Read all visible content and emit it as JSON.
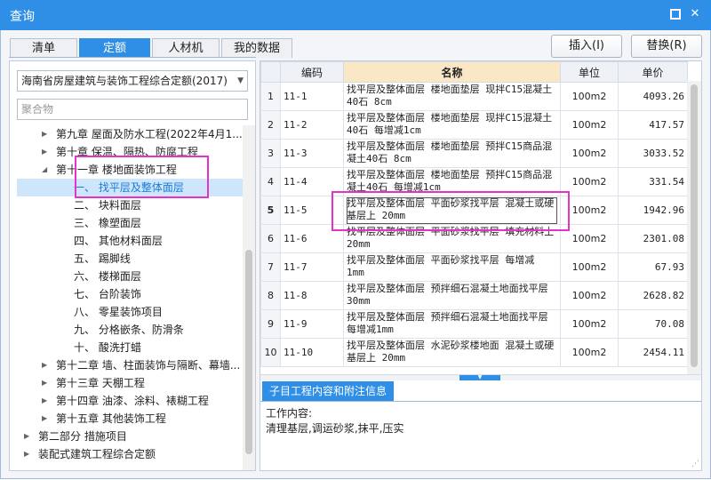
{
  "window": {
    "title": "查询",
    "restore_glyph": "▫",
    "close_glyph": "✕"
  },
  "tabs": [
    {
      "label": "清单",
      "active": false
    },
    {
      "label": "定额",
      "active": true
    },
    {
      "label": "人材机",
      "active": false
    },
    {
      "label": "我的数据",
      "active": false
    }
  ],
  "toolbar": {
    "insert_label": "插入(I)",
    "replace_label": "替换(R)"
  },
  "left": {
    "dropdown_value": "海南省房屋建筑与装饰工程综合定额(2017)",
    "search_value": "聚合物",
    "tree": [
      {
        "label": "第九章 屋面及防水工程(2022年4月1...",
        "expander": "▶",
        "level": 1,
        "selected": false
      },
      {
        "label": "第十章 保温、隔热、防腐工程",
        "expander": "▶",
        "level": 1,
        "selected": false
      },
      {
        "label": "第十一章 楼地面装饰工程",
        "expander": "◢",
        "level": 1,
        "selected": false
      },
      {
        "label": "一、 找平层及整体面层",
        "expander": "",
        "level": 2,
        "selected": true
      },
      {
        "label": "二、 块料面层",
        "expander": "",
        "level": 2,
        "selected": false
      },
      {
        "label": "三、 橡塑面层",
        "expander": "",
        "level": 2,
        "selected": false
      },
      {
        "label": "四、 其他材料面层",
        "expander": "",
        "level": 2,
        "selected": false
      },
      {
        "label": "五、 踢脚线",
        "expander": "",
        "level": 2,
        "selected": false
      },
      {
        "label": "六、 楼梯面层",
        "expander": "",
        "level": 2,
        "selected": false
      },
      {
        "label": "七、 台阶装饰",
        "expander": "",
        "level": 2,
        "selected": false
      },
      {
        "label": "八、 零星装饰项目",
        "expander": "",
        "level": 2,
        "selected": false
      },
      {
        "label": "九、 分格嵌条、防滑条",
        "expander": "",
        "level": 2,
        "selected": false
      },
      {
        "label": "十、 酸洗打蜡",
        "expander": "",
        "level": 2,
        "selected": false
      },
      {
        "label": "第十二章 墙、柱面装饰与隔断、幕墙...",
        "expander": "▶",
        "level": 1,
        "selected": false
      },
      {
        "label": "第十三章 天棚工程",
        "expander": "▶",
        "level": 1,
        "selected": false
      },
      {
        "label": "第十四章 油漆、涂料、裱糊工程",
        "expander": "▶",
        "level": 1,
        "selected": false
      },
      {
        "label": "第十五章 其他装饰工程",
        "expander": "▶",
        "level": 1,
        "selected": false
      },
      {
        "label": "第二部分 措施项目",
        "expander": "▶",
        "level": 0,
        "selected": false
      },
      {
        "label": "装配式建筑工程综合定额",
        "expander": "▶",
        "level": 0,
        "selected": false
      }
    ]
  },
  "grid": {
    "headers": {
      "code": "编码",
      "name": "名称",
      "unit": "单位",
      "price": "单价"
    },
    "rows": [
      {
        "no": "1",
        "code": "11-1",
        "name": "找平层及整体面层 楼地面垫层 现拌C15混凝土40石 8cm",
        "unit": "100m2",
        "price": "4093.26",
        "current": false
      },
      {
        "no": "2",
        "code": "11-2",
        "name": "找平层及整体面层 楼地面垫层 现拌C15混凝土40石 每增减1cm",
        "unit": "100m2",
        "price": "417.57",
        "current": false
      },
      {
        "no": "3",
        "code": "11-3",
        "name": "找平层及整体面层 楼地面垫层 预拌C15商品混凝土40石 8cm",
        "unit": "100m2",
        "price": "3033.52",
        "current": false
      },
      {
        "no": "4",
        "code": "11-4",
        "name": "找平层及整体面层 楼地面垫层 预拌C15商品混凝土40石 每增减1cm",
        "unit": "100m2",
        "price": "331.54",
        "current": false
      },
      {
        "no": "5",
        "code": "11-5",
        "name": "找平层及整体面层 平面砂浆找平层 混凝土或硬基层上 20mm",
        "unit": "100m2",
        "price": "1942.96",
        "current": true
      },
      {
        "no": "6",
        "code": "11-6",
        "name": "找平层及整体面层 平面砂浆找平层 填充材料上 20mm",
        "unit": "100m2",
        "price": "2301.08",
        "current": false
      },
      {
        "no": "7",
        "code": "11-7",
        "name": "找平层及整体面层 平面砂浆找平层 每增减 1mm",
        "unit": "100m2",
        "price": "67.93",
        "current": false
      },
      {
        "no": "8",
        "code": "11-8",
        "name": "找平层及整体面层 预拌细石混凝土地面找平层 30mm",
        "unit": "100m2",
        "price": "2628.82",
        "current": false
      },
      {
        "no": "9",
        "code": "11-9",
        "name": "找平层及整体面层 预拌细石混凝土地面找平层 每增减1mm",
        "unit": "100m2",
        "price": "70.08",
        "current": false
      },
      {
        "no": "10",
        "code": "11-10",
        "name": "找平层及整体面层 水泥砂浆楼地面 混凝土或硬基层上 20mm",
        "unit": "100m2",
        "price": "2454.11",
        "current": false
      }
    ]
  },
  "info": {
    "tab_label": "子目工程内容和附注信息",
    "line1": "工作内容:",
    "line2": "清理基层,调运砂浆,抹平,压实"
  },
  "colors": {
    "accent": "#2f8ee6",
    "selection": "#cde6fb",
    "highlight_border": "#e532c8",
    "header_highlight": "#f9e7c6"
  }
}
